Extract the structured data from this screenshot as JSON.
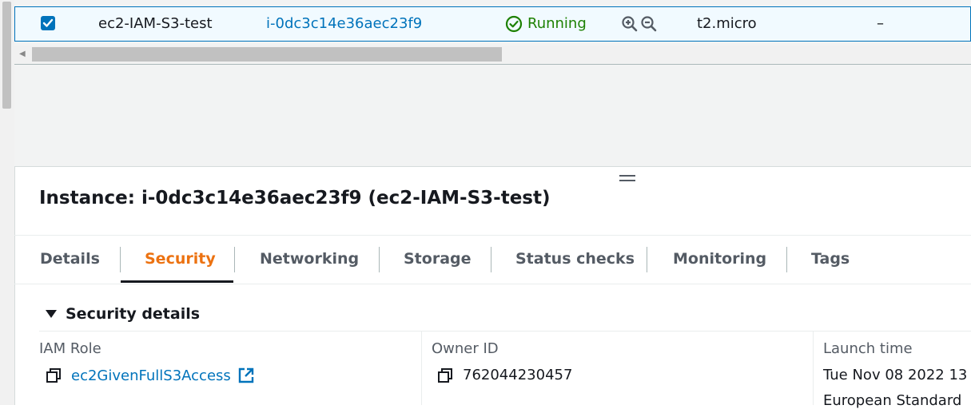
{
  "table_row": {
    "name": "ec2-IAM-S3-test",
    "instance_id": "i-0dc3c14e36aec23f9",
    "status": "Running",
    "instance_type": "t2.micro",
    "extra": "–"
  },
  "instance": {
    "title": "Instance: i-0dc3c14e36aec23f9 (ec2-IAM-S3-test)"
  },
  "tabs": [
    {
      "label": "Details"
    },
    {
      "label": "Security"
    },
    {
      "label": "Networking"
    },
    {
      "label": "Storage"
    },
    {
      "label": "Status checks"
    },
    {
      "label": "Monitoring"
    },
    {
      "label": "Tags"
    }
  ],
  "active_tab": "Security",
  "security": {
    "header": "Security details",
    "iam_role_label": "IAM Role",
    "iam_role_value": "ec2GivenFullS3Access",
    "owner_id_label": "Owner ID",
    "owner_id_value": "762044230457",
    "launch_time_label": "Launch time",
    "launch_time_value": "Tue Nov 08 2022 13",
    "launch_time_value_2": "European Standard"
  },
  "colors": {
    "accent": "#0073bb",
    "running": "#1d8102",
    "active_tab": "#ec7211"
  },
  "icons": [
    "checkbox-checked-icon",
    "status-running-icon",
    "zoom-in-icon",
    "zoom-out-icon",
    "resize-handle-icon",
    "triangle-down-icon",
    "copy-icon",
    "external-link-icon"
  ]
}
